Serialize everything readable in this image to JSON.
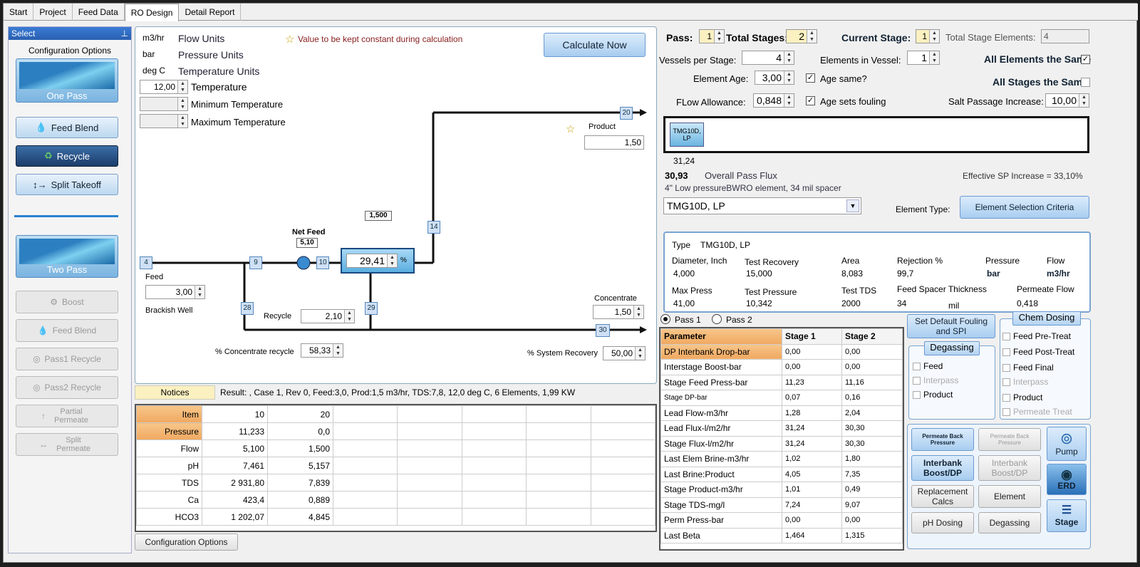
{
  "tabs": [
    "Start",
    "Project",
    "Feed Data",
    "RO Design",
    "Detail Report"
  ],
  "sidebar": {
    "header": "Select",
    "config_title": "Configuration Options",
    "one_pass": "One Pass",
    "feed_blend": "Feed Blend",
    "recycle": "Recycle",
    "split_takeoff": "Split Takeoff",
    "two_pass": "Two Pass",
    "boost": "Boost",
    "feed_blend2": "Feed Blend",
    "pass1_recycle": "Pass1 Recycle",
    "pass2_recycle": "Pass2 Recycle",
    "partial_permeate": "Partial Permeate",
    "split_permeate": "Split Permeate"
  },
  "units": {
    "flow_unit": "m3/hr",
    "flow_label": "Flow Units",
    "pressure_unit": "bar",
    "pressure_label": "Pressure Units",
    "temp_unit": "deg C",
    "temp_label": "Temperature Units",
    "temperature_value": "12,00",
    "temperature_label": "Temperature",
    "min_temp_label": "Minimum Temperature",
    "max_temp_label": "Maximum Temperature",
    "constant_note": "Value to be kept constant during calculation",
    "calculate": "Calculate Now"
  },
  "flow": {
    "product_label": "Product",
    "product_value": "1,50",
    "node20": "20",
    "node14": "14",
    "node4": "4",
    "node9": "9",
    "node10": "10",
    "node28": "28",
    "node29": "29",
    "node30": "30",
    "top_box": "1,500",
    "net_feed_label": "Net Feed",
    "net_feed_value": "5,10",
    "recovery_value": "29,41",
    "recovery_unit": "%",
    "feed_label": "Feed",
    "feed_value": "3,00",
    "source": "Brackish Well",
    "recycle_label": "Recycle",
    "recycle_value": "2,10",
    "concentrate_label": "Concentrate",
    "concentrate_value": "1,50",
    "conc_recycle_label": "% Concentrate recycle",
    "conc_recycle_value": "58,33",
    "sys_recovery_label": "% System Recovery",
    "sys_recovery_value": "50,00"
  },
  "notices": {
    "button": "Notices",
    "result": "Result: , Case 1, Rev 0, Feed:3,0, Prod:1,5 m3/hr, TDS:7,8, 12,0 deg C, 6 Elements, 1,99 KW"
  },
  "stream_table": {
    "headers": [
      "Item",
      "10",
      "20"
    ],
    "rows": [
      [
        "Pressure",
        "11,233",
        "0,0"
      ],
      [
        "Flow",
        "5,100",
        "1,500"
      ],
      [
        "pH",
        "7,461",
        "5,157"
      ],
      [
        "TDS",
        "2 931,80",
        "7,839"
      ],
      [
        "Ca",
        "423,4",
        "0,889"
      ],
      [
        "HCO3",
        "1 202,07",
        "4,845"
      ]
    ]
  },
  "config_options_btn": "Configuration Options",
  "stage": {
    "pass_label": "Pass:",
    "pass_value": "1",
    "total_stages_label": "Total Stages:",
    "total_stages_value": "2",
    "current_stage_label": "Current Stage:",
    "current_stage_value": "1",
    "total_elements_label": "Total Stage Elements:",
    "total_elements_value": "4",
    "vessels_label": "Vessels per Stage:",
    "vessels_value": "4",
    "elements_vessel_label": "Elements in Vessel:",
    "elements_vessel_value": "1",
    "all_elements_same": "All Elements the Same",
    "element_age_label": "Element Age:",
    "element_age_value": "3,00",
    "age_same": "Age same?",
    "all_stages_same": "All Stages the Same",
    "flow_allowance_label": "FLow Allowance:",
    "flow_allowance_value": "0,848",
    "age_fouling": "Age sets fouling",
    "salt_passage_label": "Salt Passage Increase:",
    "salt_passage_value": "10,00",
    "element_chip": "TMG10D, LP",
    "element_flux": "31,24",
    "overall_flux_value": "30,93",
    "overall_flux_label": "Overall Pass Flux",
    "effective_sp": "Effective SP Increase = 33,10%",
    "element_desc": "4\" Low pressureBWRO element, 34 mil spacer",
    "element_select": "TMG10D, LP",
    "element_type_label": "Element Type:",
    "selection_criteria": "Element Selection Criteria"
  },
  "element_info": {
    "type_label": "Type",
    "type_value": "TMG10D, LP",
    "diameter_label": "Diameter, Inch",
    "diameter_value": "4,000",
    "test_recovery_label": "Test Recovery",
    "test_recovery_value": "15,000",
    "area_label": "Area",
    "area_value": "8,083",
    "rejection_label": "Rejection %",
    "rejection_value": "99,7",
    "pressure_label": "Pressure",
    "pressure_unit": "bar",
    "flow_label": "Flow",
    "flow_unit": "m3/hr",
    "max_press_label": "Max Press",
    "max_press_value": "41,00",
    "test_pressure_label": "Test Pressure",
    "test_pressure_value": "10,342",
    "test_tds_label": "Test TDS",
    "test_tds_value": "2000",
    "spacer_label": "Feed Spacer Thickness",
    "spacer_value": "34",
    "spacer_unit": "mil",
    "permeate_flow_label": "Permeate Flow",
    "permeate_flow_value": "0,418"
  },
  "pass_radio": {
    "pass1": "Pass 1",
    "pass2": "Pass 2"
  },
  "param_table": {
    "headers": [
      "Parameter",
      "Stage 1",
      "Stage 2"
    ],
    "rows": [
      [
        "DP Interbank Drop-bar",
        "0,00",
        "0,00"
      ],
      [
        "Interstage Boost-bar",
        "0,00",
        "0,00"
      ],
      [
        "Stage Feed Press-bar",
        "11,23",
        "11,16"
      ],
      [
        "Stage DP-bar",
        "0,07",
        "0,16"
      ],
      [
        "Lead Flow-m3/hr",
        "1,28",
        "2,04"
      ],
      [
        "Lead Flux-l/m2/hr",
        "31,24",
        "30,30"
      ],
      [
        "Stage Flux-l/m2/hr",
        "31,24",
        "30,30"
      ],
      [
        "Last Elem Brine-m3/hr",
        "1,02",
        "1,80"
      ],
      [
        "Last Brine:Product",
        "4,05",
        "7,35"
      ],
      [
        "Stage Product-m3/hr",
        "1,01",
        "0,49"
      ],
      [
        "Stage TDS-mg/l",
        "7,24",
        "9,07"
      ],
      [
        "Perm Press-bar",
        "0,00",
        "0,00"
      ],
      [
        "Last Beta",
        "1,464",
        "1,315"
      ]
    ]
  },
  "right_buttons": {
    "set_default": "Set Default Fouling and SPI",
    "degassing_title": "Degassing",
    "deg_feed": "Feed",
    "deg_interpass": "Interpass",
    "deg_product": "Product",
    "chem_title": "Chem Dosing",
    "chem_pre": "Feed Pre-Treat",
    "chem_post": "Feed Post-Treat",
    "chem_final": "Feed Final",
    "chem_interpass": "Interpass",
    "chem_product": "Product",
    "chem_perm": "Permeate Treat",
    "perm_back1": "Permeate Back Pressure",
    "perm_back2": "Permeate Back Pressure",
    "pump": "Pump",
    "interbank1": "Interbank Boost/DP",
    "interbank2": "Interbank Boost/DP",
    "erd": "ERD",
    "replacement": "Replacement Calcs",
    "element": "Element",
    "ph_dosing": "pH Dosing",
    "degassing": "Degassing",
    "stage": "Stage"
  }
}
